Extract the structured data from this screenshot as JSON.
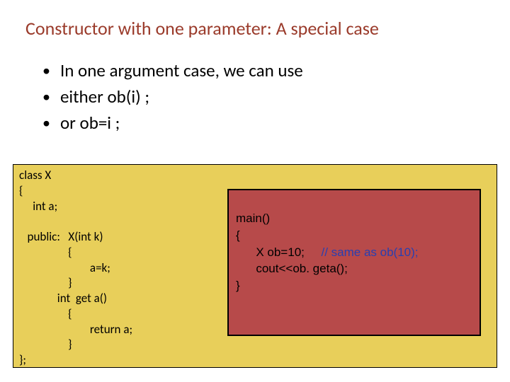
{
  "title": "Constructor with one parameter: A special case",
  "bullets": [
    "In one argument case, we can use",
    "either  ob(i) ;",
    "or ob=i ;"
  ],
  "code_left": "class X\n{\n     int a;\n\n   public:   X(int k)\n                  {\n                          a=k;\n                  }\n              int  get a()\n                  {\n                          return a;\n                  }\n};",
  "code_right_pre": "main()\n{\n      X ob=10;     ",
  "code_right_comment": "// same as ob(10);",
  "code_right_post": "\n      cout<<ob. geta();\n}"
}
